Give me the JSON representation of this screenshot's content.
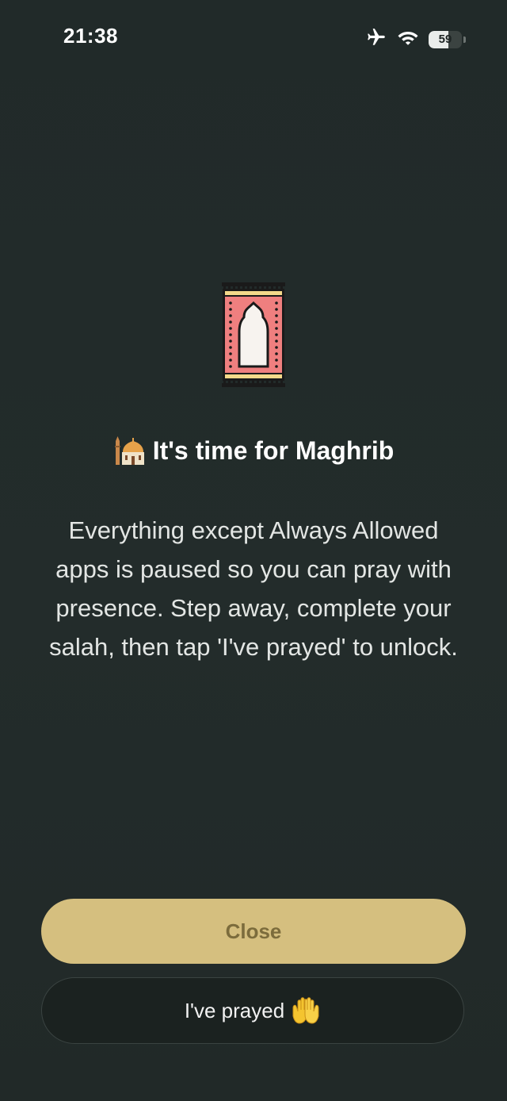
{
  "status_bar": {
    "time": "21:38",
    "battery_level": "59",
    "icons": [
      "airplane-icon",
      "wifi-icon",
      "battery-icon"
    ]
  },
  "hero": {
    "icon": "prayer-rug-icon"
  },
  "title": {
    "text": "It's time for Maghrib",
    "icon": "mosque-icon"
  },
  "description": "Everything except Always Allowed apps is paused so you can pray with presence. Step away, complete your salah, then tap 'I've prayed' to unlock.",
  "buttons": {
    "close_label": "Close",
    "prayed_label": "I've prayed",
    "prayed_icon": "raised-hands-icon"
  },
  "colors": {
    "background": "#222b2a",
    "accent": "#d5bf7f",
    "accent_text": "#7c6c3c",
    "secondary_button": "#1b2220"
  }
}
